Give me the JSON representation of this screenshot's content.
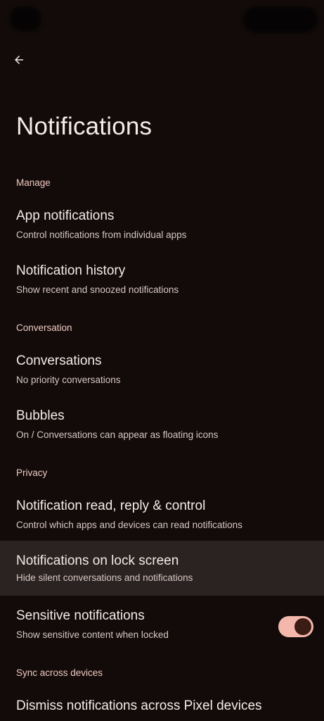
{
  "header": {
    "title": "Notifications"
  },
  "sections": {
    "manage": "Manage",
    "conversation": "Conversation",
    "privacy": "Privacy",
    "sync": "Sync across devices"
  },
  "items": {
    "app_notifications": {
      "title": "App notifications",
      "summary": "Control notifications from individual apps"
    },
    "notification_history": {
      "title": "Notification history",
      "summary": "Show recent and snoozed notifications"
    },
    "conversations": {
      "title": "Conversations",
      "summary": "No priority conversations"
    },
    "bubbles": {
      "title": "Bubbles",
      "summary": "On / Conversations can appear as floating icons"
    },
    "read_reply_control": {
      "title": "Notification read, reply & control",
      "summary": "Control which apps and devices can read notifications"
    },
    "lock_screen": {
      "title": "Notifications on lock screen",
      "summary": "Hide silent conversations and notifications"
    },
    "sensitive": {
      "title": "Sensitive notifications",
      "summary": "Show sensitive content when locked",
      "toggle_on": true
    },
    "dismiss_across": {
      "title": "Dismiss notifications across Pixel devices"
    }
  },
  "colors": {
    "background": "#120b0a",
    "accent": "#f3b8ab",
    "section_header": "#f0c9c0",
    "highlight": "#2a2321"
  },
  "icons": {
    "back": "arrow-left-icon"
  }
}
